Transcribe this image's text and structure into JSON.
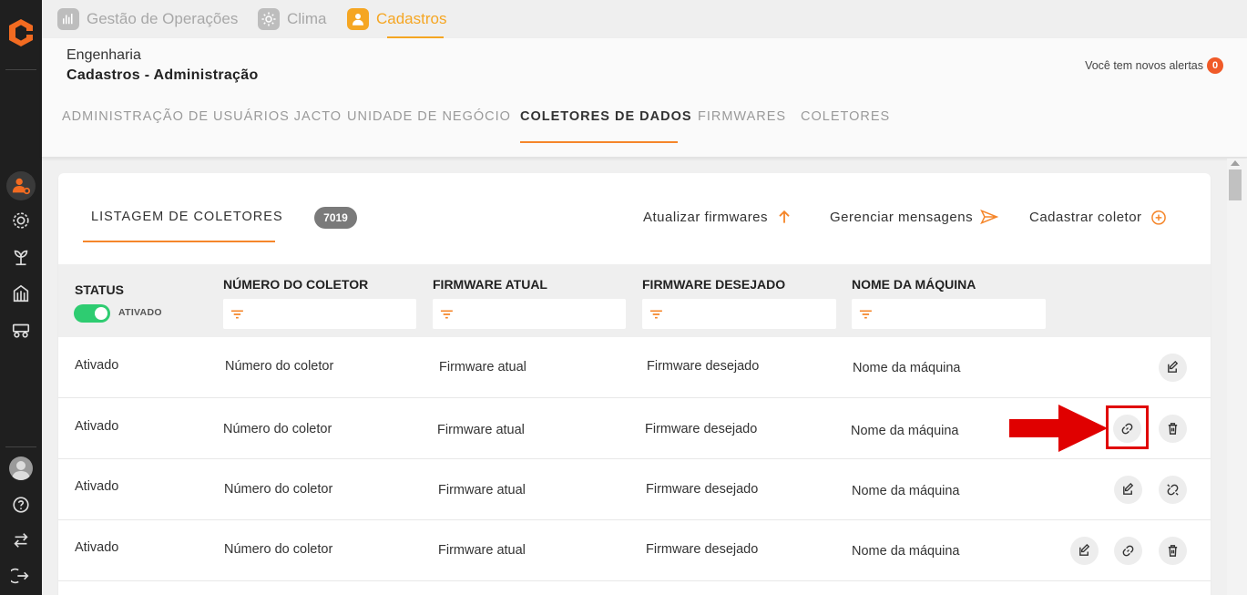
{
  "topnav": {
    "items": [
      {
        "label": "Gestão de Operações",
        "icon": "chart-icon"
      },
      {
        "label": "Clima",
        "icon": "sun-icon"
      },
      {
        "label": "Cadastros",
        "icon": "user-icon"
      }
    ]
  },
  "header": {
    "breadcrumb_parent": "Engenharia",
    "breadcrumb_title": "Cadastros - Administração",
    "alerts_text": "Você tem novos alertas",
    "alerts_count": "0"
  },
  "tabs": [
    {
      "label": "ADMINISTRAÇÃO DE USUÁRIOS JACTO"
    },
    {
      "label": "UNIDADE DE NEGÓCIO"
    },
    {
      "label": "COLETORES DE DADOS"
    },
    {
      "label": "FIRMWARES"
    },
    {
      "label": "COLETORES"
    }
  ],
  "card": {
    "title": "LISTAGEM DE COLETORES",
    "count": "7019",
    "actions": {
      "update_firmware": "Atualizar firmwares",
      "manage_messages": "Gerenciar mensagens",
      "register_collector": "Cadastrar coletor"
    }
  },
  "table": {
    "columns": {
      "status": "STATUS",
      "status_toggle": "ATIVADO",
      "collector_number": "NÚMERO DO COLETOR",
      "current_firmware": "FIRMWARE ATUAL",
      "desired_firmware": "FIRMWARE DESEJADO",
      "machine_name": "NOME DA MÁQUINA"
    },
    "rows": [
      {
        "status": "Ativado",
        "collector": "Número do coletor",
        "current": "Firmware atual",
        "desired": "Firmware desejado",
        "machine": "Nome da máquina"
      },
      {
        "status": "Ativado",
        "collector": "Número do coletor",
        "current": "Firmware atual",
        "desired": "Firmware desejado",
        "machine": "Nome da máquina"
      },
      {
        "status": "Ativado",
        "collector": "Número do coletor",
        "current": "Firmware atual",
        "desired": "Firmware desejado",
        "machine": "Nome da máquina"
      },
      {
        "status": "Ativado",
        "collector": "Número do coletor",
        "current": "Firmware atual",
        "desired": "Firmware desejado",
        "machine": "Nome da máquina"
      }
    ]
  },
  "colors": {
    "accent": "#f5862a",
    "toggle_on": "#2ecc71",
    "annotation": "#e00000"
  }
}
